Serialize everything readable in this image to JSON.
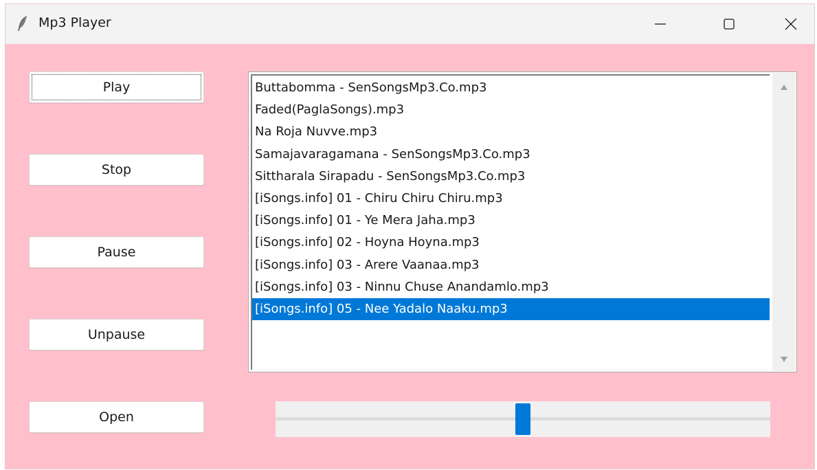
{
  "window": {
    "title": "Mp3 Player"
  },
  "colors": {
    "background": "#ffc0cb",
    "accent": "#0078d7",
    "selection": "#0078d7"
  },
  "icons": {
    "app": "feather-icon",
    "minimize": "minimize-icon",
    "maximize": "maximize-icon",
    "close": "close-icon"
  },
  "buttons": {
    "play": "Play",
    "stop": "Stop",
    "pause": "Pause",
    "unpause": "Unpause",
    "open": "Open"
  },
  "playlist": {
    "items": [
      "Buttabomma - SenSongsMp3.Co.mp3",
      "Faded(PaglaSongs).mp3",
      "Na Roja Nuvve.mp3",
      "Samajavaragamana - SenSongsMp3.Co.mp3",
      "Sittharala Sirapadu - SenSongsMp3.Co.mp3",
      "[iSongs.info] 01 - Chiru Chiru Chiru.mp3",
      "[iSongs.info] 01 - Ye Mera Jaha.mp3",
      "[iSongs.info] 02 - Hoyna Hoyna.mp3",
      "[iSongs.info] 03 - Arere Vaanaa.mp3",
      "[iSongs.info] 03 - Ninnu Chuse Anandamlo.mp3",
      "[iSongs.info] 05 - Nee Yadalo Naaku.mp3"
    ],
    "selected_index": 10
  },
  "volume": {
    "level": 0.5
  }
}
